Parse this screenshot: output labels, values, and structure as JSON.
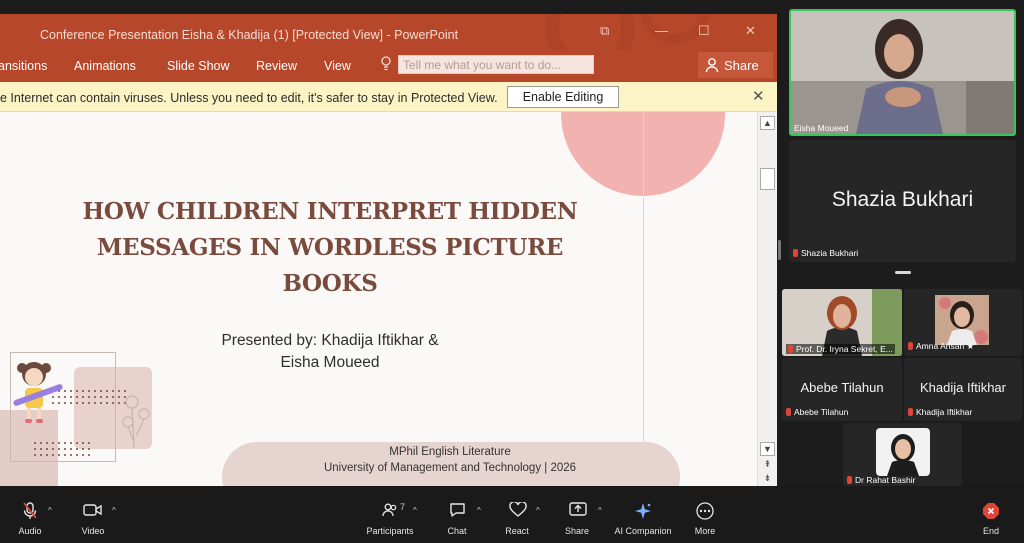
{
  "powerpoint": {
    "title": "Conference Presentation Eisha & Khadija (1) [Protected View] - PowerPoint",
    "tabs": [
      "ansitions",
      "Animations",
      "Slide Show",
      "Review",
      "View"
    ],
    "tell_me_placeholder": "Tell me what you want to do...",
    "share_label": "Share",
    "protected_message": "e Internet can contain viruses. Unless you need to edit, it's safer to stay in Protected View.",
    "enable_editing_label": "Enable Editing",
    "close_glyph": "✕"
  },
  "slide": {
    "title_line1": "HOW CHILDREN INTERPRET HIDDEN",
    "title_line2": "MESSAGES IN WORDLESS PICTURE",
    "title_line3": "BOOKS",
    "presented_line1": "Presented by: Khadija Iftikhar &",
    "presented_line2": "Eisha Moueed",
    "course_line1": "MPhil English Literature",
    "course_line2": "University of Management and Technology | 2026"
  },
  "participants": {
    "eisha": "Eisha Moueed",
    "shazia_big": "Shazia Bukhari",
    "shazia_small": "Shazia Bukhari",
    "iryna": "Prof. Dr. Iryna Sekret, E...",
    "amna": "Amna Ahsan ★",
    "abebe_big": "Abebe Tilahun",
    "abebe_small": "Abebe Tilahun",
    "khadija_big": "Khadija Iftikhar",
    "khadija_small": "Khadija Iftikhar",
    "rahat": "Dr Rahat Bashir"
  },
  "toolbar": {
    "audio": "Audio",
    "video": "Video",
    "participants": "Participants",
    "participants_count": "7",
    "chat": "Chat",
    "react": "React",
    "share": "Share",
    "ai_companion": "AI Companion",
    "more": "More",
    "end": "End"
  },
  "colors": {
    "ppt_accent": "#b7472a",
    "protected_bar": "#fdf4c6",
    "active_speaker": "#39c459",
    "end_red": "#e0453a",
    "slide_title": "#7a4a3c"
  }
}
